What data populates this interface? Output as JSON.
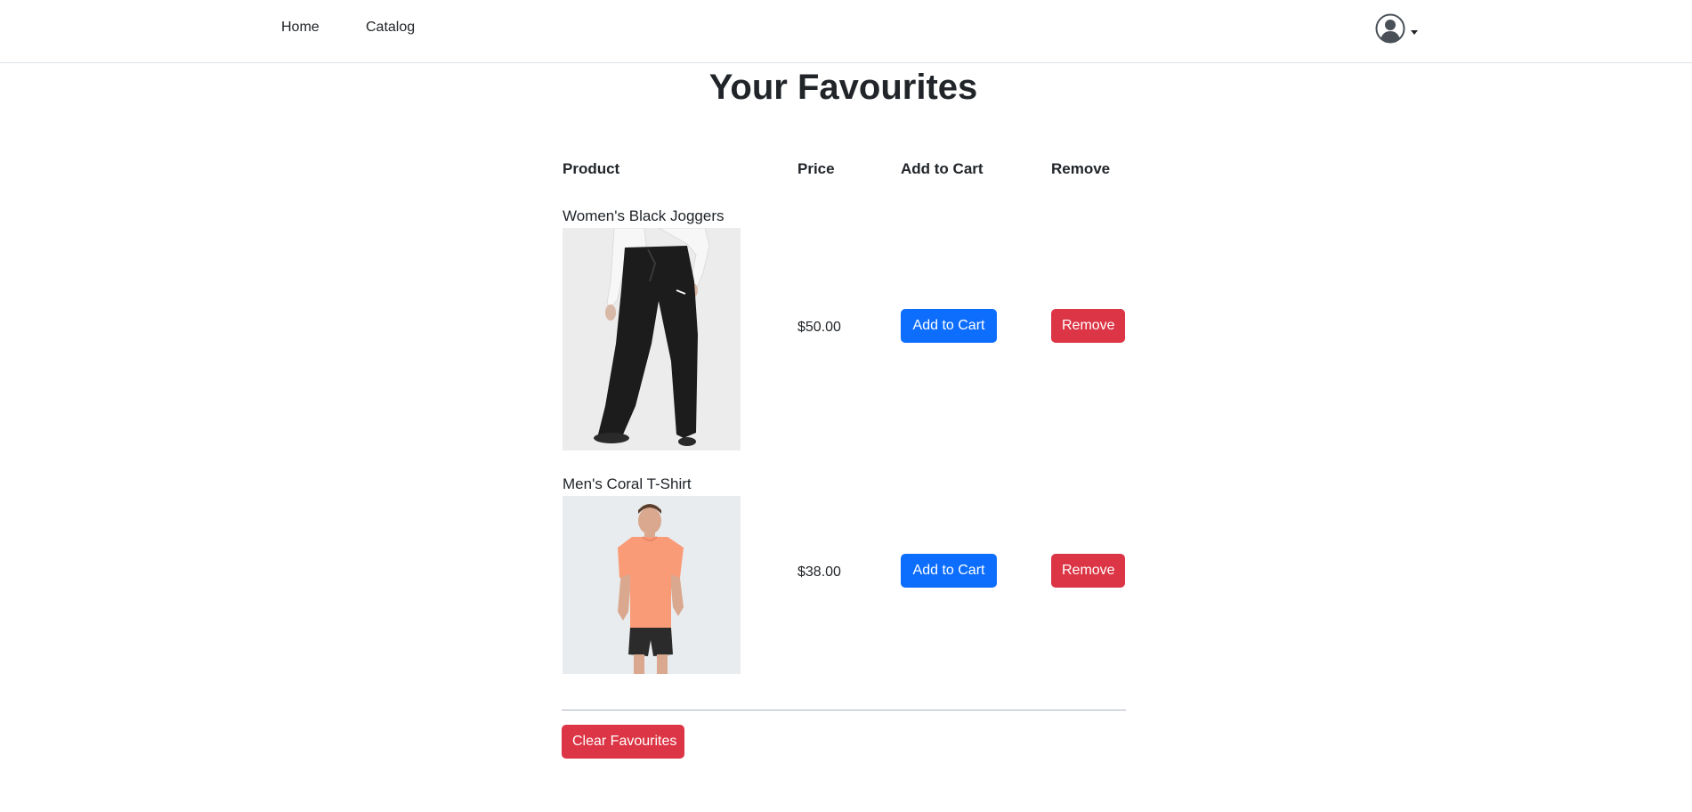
{
  "navbar": {
    "home_label": "Home",
    "catalog_label": "Catalog",
    "user_icon": "user-circle-icon",
    "caret_icon": "caret-down-icon"
  },
  "page": {
    "title": "Your Favourites"
  },
  "table": {
    "headers": {
      "product": "Product",
      "price": "Price",
      "add_to_cart": "Add to Cart",
      "remove": "Remove"
    },
    "rows": [
      {
        "name": "Women's Black Joggers",
        "price": "$50.00",
        "add_label": "Add to Cart",
        "remove_label": "Remove"
      },
      {
        "name": "Men's Coral T-Shirt",
        "price": "$38.00",
        "add_label": "Add to Cart",
        "remove_label": "Remove"
      }
    ]
  },
  "actions": {
    "clear_label": "Clear Favourites"
  },
  "colors": {
    "primary": "#0d6efd",
    "danger": "#dc3545",
    "text": "#212529"
  }
}
